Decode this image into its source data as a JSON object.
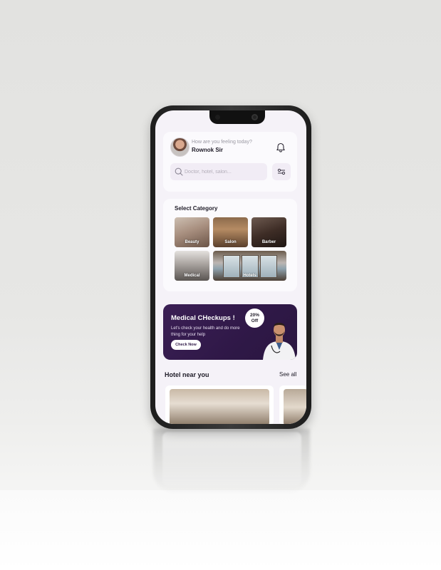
{
  "header": {
    "greeting": "How are you feeling today?",
    "user_name": "Rownok Sir"
  },
  "search": {
    "placeholder": "Doctor, hotel, salon..."
  },
  "categories": {
    "title": "Select Category",
    "items": [
      {
        "label": "Beauty"
      },
      {
        "label": "Salon"
      },
      {
        "label": "Barber"
      },
      {
        "label": "Medical"
      },
      {
        "label": "Hotels"
      }
    ]
  },
  "promo": {
    "title": "Medical CHeckups !",
    "subtitle": "Let's check your health and do more thing for your help",
    "button_label": "Check Now",
    "badge": "20% Off"
  },
  "hotels_section": {
    "title": "Hotel near you",
    "see_all_label": "See all"
  },
  "colors": {
    "accent": "#2f1847",
    "background": "#f5f2f8",
    "card": "#fbfafd"
  },
  "icons": [
    "bell-icon",
    "search-icon",
    "filter-icon"
  ]
}
